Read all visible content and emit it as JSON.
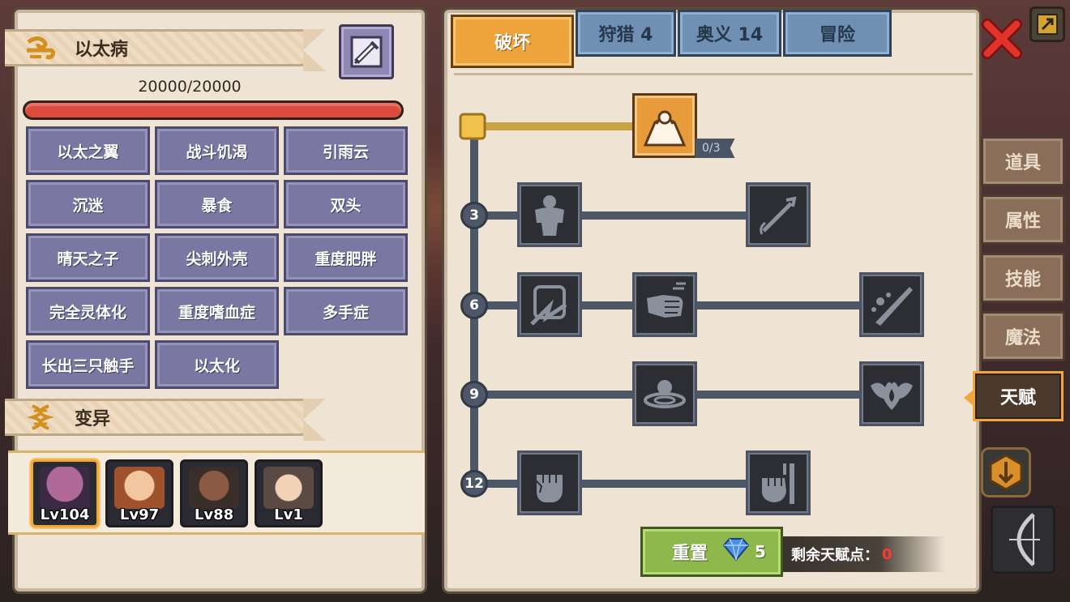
{
  "disease": {
    "title": "以太病",
    "hp_text": "20000/20000",
    "hp_fraction": 1.0,
    "traits": [
      "以太之翼",
      "战斗饥渴",
      "引雨云",
      "沉迷",
      "暴食",
      "双头",
      "晴天之子",
      "尖刺外壳",
      "重度肥胖",
      "完全灵体化",
      "重度嗜血症",
      "多手症",
      "长出三只触手",
      "以太化"
    ]
  },
  "mutation": {
    "title": "变异",
    "heroes": [
      {
        "level": "Lv104",
        "selected": true
      },
      {
        "level": "Lv97",
        "selected": false
      },
      {
        "level": "Lv88",
        "selected": false
      },
      {
        "level": "Lv1",
        "selected": false
      }
    ]
  },
  "tabs": [
    {
      "label": "破坏",
      "active": true
    },
    {
      "label": "狩猎 4",
      "active": false
    },
    {
      "label": "奥义 14",
      "active": false
    },
    {
      "label": "冒险",
      "active": false
    }
  ],
  "talent_tree": {
    "top_node_counter": "0/3",
    "tiers": [
      "3",
      "6",
      "9",
      "12"
    ]
  },
  "reset": {
    "label": "重置",
    "cost": "5"
  },
  "remaining_points": {
    "label": "剩余天赋点：",
    "value": "0"
  },
  "side_menu": [
    {
      "label": "道具",
      "active": false
    },
    {
      "label": "属性",
      "active": false
    },
    {
      "label": "技能",
      "active": false
    },
    {
      "label": "魔法",
      "active": false
    },
    {
      "label": "天赋",
      "active": true
    }
  ],
  "colors": {
    "active_tab": "#eea43a",
    "inactive_tab": "#6f8fb3",
    "trait_button": "#7a77a3",
    "hp_bar": "#dd4b3e",
    "remaining_points_value": "#ff3a2a",
    "reset_button": "#8fb84c"
  }
}
